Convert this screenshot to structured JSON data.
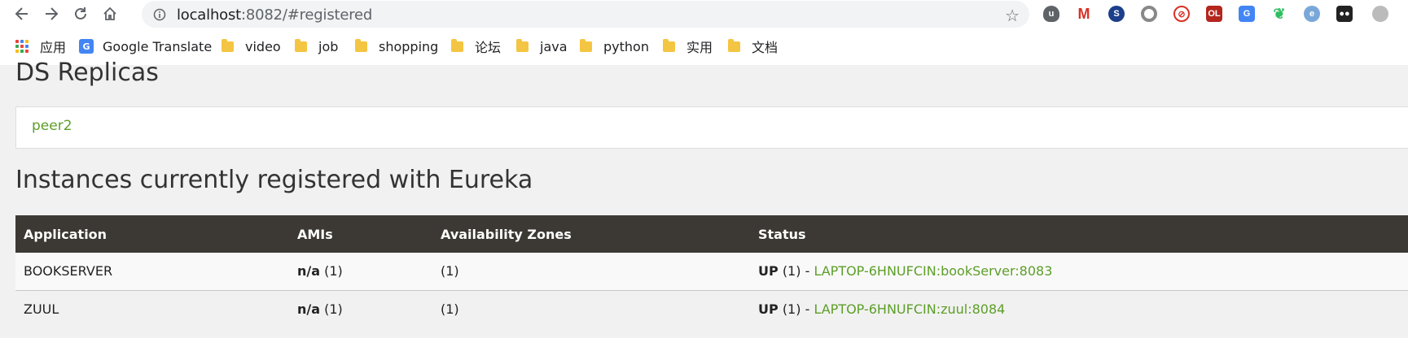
{
  "browser": {
    "url_host": "localhost",
    "url_path": ":8082/#registered",
    "extensions": [
      "ublock-icon",
      "gmail-icon",
      "sync-icon",
      "record-icon",
      "adblock-icon",
      "extension-ol-icon",
      "google-translate-icon",
      "evernote-icon",
      "edge-icon",
      "tampermonkey-icon",
      "extension-icon"
    ]
  },
  "bookmarks": {
    "apps": "应用",
    "items": [
      "Google Translate",
      "video",
      "job",
      "shopping",
      "论坛",
      "java",
      "python",
      "实用",
      "文档"
    ]
  },
  "page": {
    "ds_title": "DS Replicas",
    "replica": "peer2",
    "instances_title": "Instances currently registered with Eureka",
    "table": {
      "headers": [
        "Application",
        "AMIs",
        "Availability Zones",
        "Status"
      ],
      "rows": [
        {
          "app": "BOOKSERVER",
          "ami_bold": "n/a",
          "ami_count": "(1)",
          "zones": "(1)",
          "status_bold": "UP",
          "status_count": "(1) -",
          "instance": "LAPTOP-6HNUFCIN:bookServer:8083"
        },
        {
          "app": "ZUUL",
          "ami_bold": "n/a",
          "ami_count": "(1)",
          "zones": "(1)",
          "status_bold": "UP",
          "status_count": "(1) -",
          "instance": "LAPTOP-6HNUFCIN:zuul:8084"
        }
      ]
    }
  },
  "colors": {
    "link": "#5d9e28",
    "table_header": "#3c3833"
  }
}
